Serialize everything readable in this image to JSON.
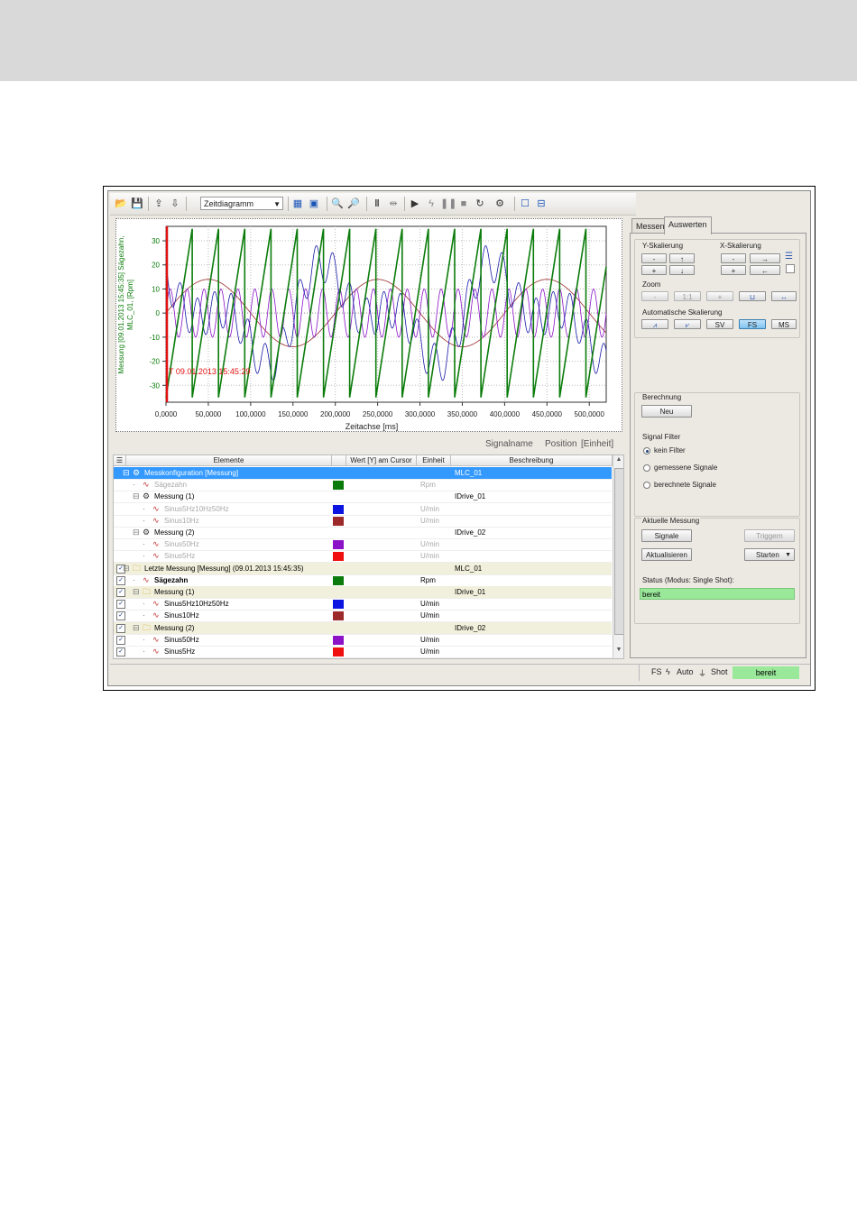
{
  "window": {
    "toolbar": {
      "diagram_combo": "Zeitdiagramm",
      "icons": [
        "open-icon",
        "save-icon",
        "export-icon",
        "import-icon",
        "table-icon",
        "copy-icon",
        "zoom-icon",
        "zoom-dropdown-icon",
        "cursor-a-icon",
        "cursor-b-icon",
        "play-icon",
        "trigger-icon",
        "pause-icon",
        "stop-icon",
        "refresh-icon",
        "settings-icon",
        "layout-single-icon",
        "layout-split-icon"
      ]
    },
    "chart": {
      "cursor_label": "T 09.01.2013 15:45:29",
      "ylabel_line1": "Messung [09.01.2013 15:45:35] Sägezahn,",
      "ylabel_line2": "MLC_01, [Rpm]",
      "xlabel": "Zeitachse [ms]"
    },
    "legend_header": {
      "signalname": "Signalname",
      "position": "Position",
      "einheit": "[Einheit]"
    },
    "grid": {
      "columns": [
        "Elemente",
        "Wert [Y] am Cursor",
        "Einheit",
        "Beschreibung"
      ],
      "rows": [
        {
          "indent": 1,
          "checked": null,
          "icon": "gear-icon",
          "label": "Messkonfiguration [Messung]",
          "color": "",
          "unit": "",
          "desc": "MLC_01",
          "selected": true,
          "dim": false,
          "bold": false,
          "band": false
        },
        {
          "indent": 2,
          "checked": null,
          "icon": "signal-icon",
          "label": "Sägezahn",
          "color": "#0b7c0b",
          "unit": "Rpm",
          "desc": "",
          "selected": false,
          "dim": true,
          "bold": false,
          "band": false
        },
        {
          "indent": 2,
          "checked": null,
          "icon": "gear-icon",
          "label": "Messung (1)",
          "color": "",
          "unit": "",
          "desc": "IDrive_01",
          "selected": false,
          "dim": false,
          "bold": false,
          "band": false
        },
        {
          "indent": 3,
          "checked": null,
          "icon": "signal-icon",
          "label": "Sinus5Hz10Hz50Hz",
          "color": "#0b14e0",
          "unit": "U/min",
          "desc": "",
          "selected": false,
          "dim": true,
          "bold": false,
          "band": false
        },
        {
          "indent": 3,
          "checked": null,
          "icon": "signal-icon",
          "label": "Sinus10Hz",
          "color": "#9c2a2a",
          "unit": "U/min",
          "desc": "",
          "selected": false,
          "dim": true,
          "bold": false,
          "band": false
        },
        {
          "indent": 2,
          "checked": null,
          "icon": "gear-icon",
          "label": "Messung (2)",
          "color": "",
          "unit": "",
          "desc": "IDrive_02",
          "selected": false,
          "dim": false,
          "bold": false,
          "band": false
        },
        {
          "indent": 3,
          "checked": null,
          "icon": "signal-icon",
          "label": "Sinus50Hz",
          "color": "#8b12c7",
          "unit": "U/min",
          "desc": "",
          "selected": false,
          "dim": true,
          "bold": false,
          "band": false
        },
        {
          "indent": 3,
          "checked": null,
          "icon": "signal-icon",
          "label": "Sinus5Hz",
          "color": "#f01010",
          "unit": "U/min",
          "desc": "",
          "selected": false,
          "dim": true,
          "bold": false,
          "band": false
        },
        {
          "indent": 1,
          "checked": true,
          "icon": "folder-icon",
          "label": "Letzte Messung [Messung] (09.01.2013 15:45:35)",
          "color": "",
          "unit": "",
          "desc": "MLC_01",
          "selected": false,
          "dim": false,
          "bold": false,
          "band": true
        },
        {
          "indent": 2,
          "checked": true,
          "icon": "signal-icon",
          "label": "Sägezahn",
          "color": "#0b7c0b",
          "unit": "Rpm",
          "desc": "",
          "selected": false,
          "dim": false,
          "bold": true,
          "band": false
        },
        {
          "indent": 2,
          "checked": true,
          "icon": "folder-icon",
          "label": "Messung (1)",
          "color": "",
          "unit": "",
          "desc": "IDrive_01",
          "selected": false,
          "dim": false,
          "bold": false,
          "band": true
        },
        {
          "indent": 3,
          "checked": true,
          "icon": "signal-icon",
          "label": "Sinus5Hz10Hz50Hz",
          "color": "#0b14e0",
          "unit": "U/min",
          "desc": "",
          "selected": false,
          "dim": false,
          "bold": false,
          "band": false
        },
        {
          "indent": 3,
          "checked": true,
          "icon": "signal-icon",
          "label": "Sinus10Hz",
          "color": "#9c2a2a",
          "unit": "U/min",
          "desc": "",
          "selected": false,
          "dim": false,
          "bold": false,
          "band": false
        },
        {
          "indent": 2,
          "checked": true,
          "icon": "folder-icon",
          "label": "Messung (2)",
          "color": "",
          "unit": "",
          "desc": "IDrive_02",
          "selected": false,
          "dim": false,
          "bold": false,
          "band": true
        },
        {
          "indent": 3,
          "checked": true,
          "icon": "signal-icon",
          "label": "Sinus50Hz",
          "color": "#8b12c7",
          "unit": "U/min",
          "desc": "",
          "selected": false,
          "dim": false,
          "bold": false,
          "band": false
        },
        {
          "indent": 3,
          "checked": true,
          "icon": "signal-icon",
          "label": "Sinus5Hz",
          "color": "#f01010",
          "unit": "U/min",
          "desc": "",
          "selected": false,
          "dim": false,
          "bold": false,
          "band": false
        }
      ]
    },
    "right_panel": {
      "tabs": [
        "Messen",
        "Auswerten"
      ],
      "active_tab": "Auswerten",
      "y_scaling": {
        "title": "Y-Skalierung",
        "minus": "-",
        "plus": "+",
        "up": "↑",
        "down": "↓"
      },
      "x_scaling": {
        "title": "X-Skalierung",
        "minus": "-",
        "plus": "+",
        "right": "→",
        "left": "←"
      },
      "zoom": {
        "title": "Zoom",
        "minus": "-",
        "one": "1:1",
        "plus": "+"
      },
      "auto_scaling": {
        "title": "Automatische Skalierung",
        "sv": "SV",
        "fs": "FS",
        "ms": "MS"
      },
      "berechnung": {
        "title": "Berechnung",
        "neu": "Neu"
      },
      "signal_filter": {
        "title": "Signal Filter",
        "options": [
          "kein Filter",
          "gemessene Signale",
          "berechnete Signale"
        ],
        "selected": 0
      },
      "aktuelle_messung": {
        "title": "Aktuelle Messung",
        "signale": "Signale",
        "triggern": "Triggern",
        "aktualisieren": "Aktualisieren",
        "starten": "Starten",
        "status_label": "Status (Modus: Single Shot):",
        "status_value": "bereit",
        "status_color": "#9ae89a"
      }
    },
    "statusbar": {
      "fs": "FS",
      "auto": "Auto",
      "shot": "Shot",
      "state": "bereit"
    }
  },
  "chart_data": {
    "type": "line",
    "xlabel": "Zeitachse [ms]",
    "ylabel": "Messung [09.01.2013 15:45:35] Sägezahn, MLC_01, [Rpm]",
    "xlim": [
      0,
      520
    ],
    "ylim": [
      -37,
      36
    ],
    "xticks": [
      0,
      50,
      100,
      150,
      200,
      250,
      300,
      350,
      400,
      450,
      500
    ],
    "xtick_labels": [
      "0,0000",
      "50,0000",
      "100,0000",
      "150,0000",
      "200,0000",
      "250,0000",
      "300,0000",
      "350,0000",
      "400,0000",
      "450,0000",
      "500,0000"
    ],
    "yticks": [
      -30,
      -20,
      -10,
      0,
      10,
      20,
      30
    ],
    "grid": true,
    "cursor_x": 0,
    "series": [
      {
        "color": "#0b7c0b",
        "kind": "sawtooth",
        "amplitude": 35,
        "period_ms": 31,
        "offset": 0
      },
      {
        "color": "#1a1aa8",
        "kind": "sum_of_sines",
        "components": [
          [
            14,
            5
          ],
          [
            10,
            10
          ],
          [
            8,
            50
          ]
        ]
      },
      {
        "color": "#9c2a2a",
        "kind": "sine",
        "amplitude": 14,
        "freq_hz": 5
      },
      {
        "color": "#8b12c7",
        "kind": "sine",
        "amplitude": 10,
        "freq_hz": 50
      }
    ]
  }
}
